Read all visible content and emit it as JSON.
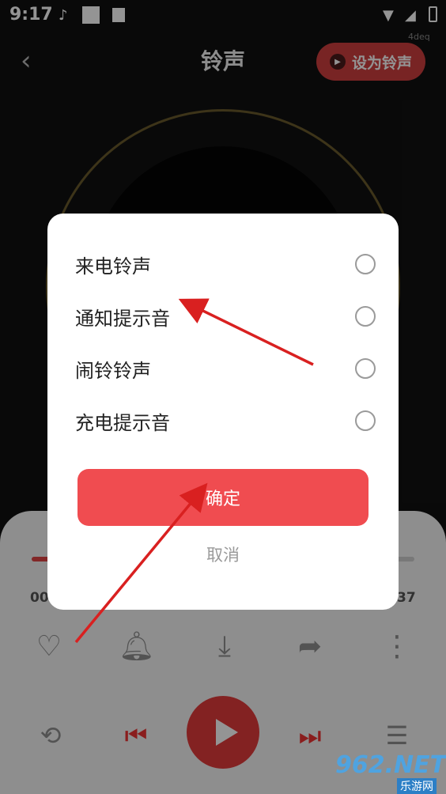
{
  "status_bar": {
    "time": "9:17"
  },
  "header": {
    "back_icon": "chevron-left-icon",
    "title": "铃声",
    "set_button_label": "设为铃声",
    "tag": "4deq"
  },
  "player": {
    "time_left": "00",
    "time_right": "37",
    "actions": [
      "heart-icon",
      "bell-icon",
      "download-icon",
      "share-icon",
      "more-vertical-icon"
    ],
    "controls": [
      "repeat-icon",
      "prev-icon",
      "play-icon",
      "next-icon",
      "playlist-icon"
    ]
  },
  "dialog": {
    "options": [
      {
        "label": "来电铃声",
        "selected": false
      },
      {
        "label": "通知提示音",
        "selected": false
      },
      {
        "label": "闹铃铃声",
        "selected": false
      },
      {
        "label": "充电提示音",
        "selected": false
      }
    ],
    "confirm_label": "确定",
    "cancel_label": "取消"
  },
  "watermark": {
    "text": "962.NET",
    "subtext": "乐游网"
  },
  "colors": {
    "accent": "#f04c50",
    "dialog_bg": "#ffffff",
    "arrow": "#d92020"
  }
}
